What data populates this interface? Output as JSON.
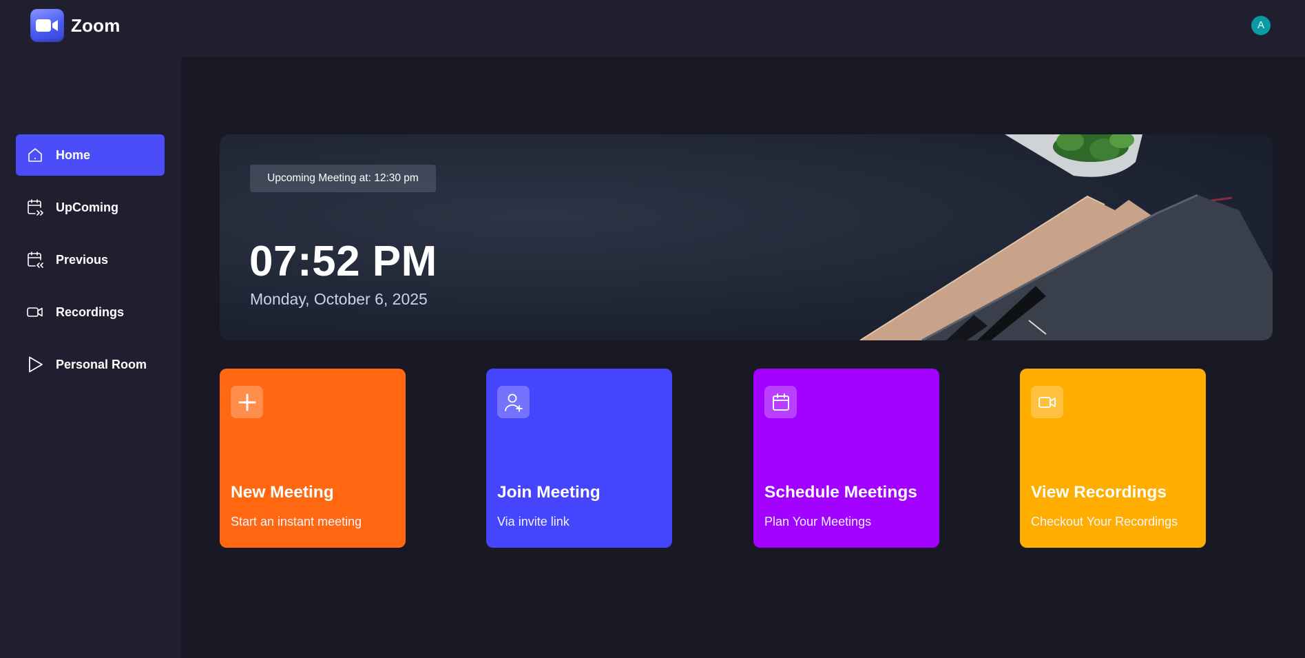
{
  "app": {
    "brand": "Zoom",
    "avatar_initial": "A"
  },
  "sidebar": {
    "items": [
      {
        "label": "Home",
        "icon": "home-icon",
        "active": true
      },
      {
        "label": "UpComing",
        "icon": "calendar-forward-icon",
        "active": false
      },
      {
        "label": "Previous",
        "icon": "calendar-back-icon",
        "active": false
      },
      {
        "label": "Recordings",
        "icon": "video-icon",
        "active": false
      },
      {
        "label": "Personal Room",
        "icon": "play-icon",
        "active": false
      }
    ]
  },
  "hero": {
    "upcoming_label": "Upcoming Meeting at: 12:30 pm",
    "time": "07:52 PM",
    "date": "Monday, October 6, 2025"
  },
  "cards": [
    {
      "title": "New Meeting",
      "subtitle": "Start an instant meeting",
      "icon": "plus-icon",
      "color": "#ff6811"
    },
    {
      "title": "Join Meeting",
      "subtitle": "Via invite link",
      "icon": "user-plus-icon",
      "color": "#4545fe"
    },
    {
      "title": "Schedule Meetings",
      "subtitle": "Plan Your Meetings",
      "icon": "calendar-icon",
      "color": "#a200ff"
    },
    {
      "title": "View Recordings",
      "subtitle": "Checkout Your Recordings",
      "icon": "video-icon",
      "color": "#ffae00"
    }
  ],
  "colors": {
    "accent": "#4b4ef8",
    "background": "#191926",
    "panel": "#1f1f30",
    "avatar": "#0a9aa6"
  }
}
